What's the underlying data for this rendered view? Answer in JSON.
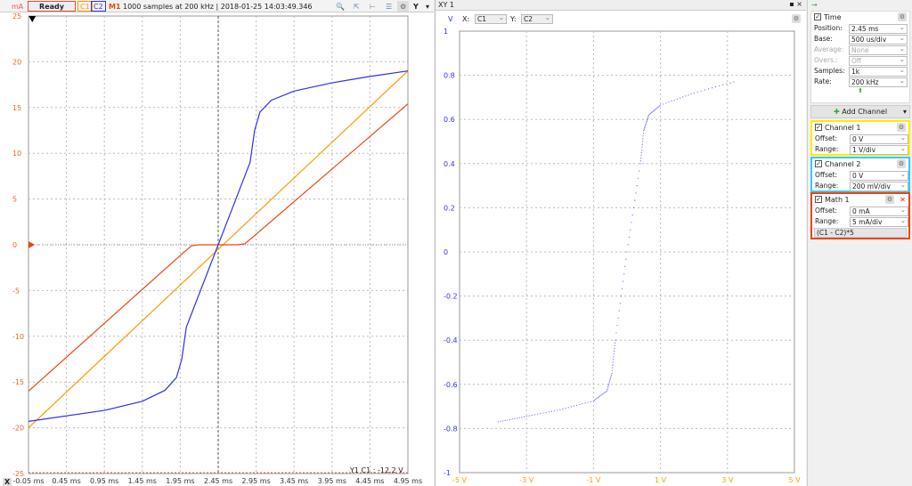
{
  "toolbar": {
    "unit": "mA",
    "status": "Ready",
    "c1": "C1",
    "c2": "C2",
    "m1": "M1",
    "info": "1000 samples at 200 kHz | 2018-01-25 14:03:49.346",
    "y_button": "Y",
    "x_button": "X"
  },
  "colors": {
    "c1": "#ff9900",
    "c2": "#3030ee",
    "m1": "#ee4411",
    "xy": "#6666ff"
  },
  "cursor_readout": "Y1 C1 : -12.2 V",
  "xy": {
    "title": "XY 1",
    "y_unit": "V",
    "x_label": "X:",
    "x_value": "C1",
    "y_label": "Y:",
    "y_value": "C2"
  },
  "side": {
    "time": {
      "title": "Time",
      "position_label": "Position:",
      "position": "2.45 ms",
      "base_label": "Base:",
      "base": "500 us/div",
      "average_label": "Average:",
      "average": "None",
      "overs_label": "Overs.:",
      "overs": "Off",
      "samples_label": "Samples:",
      "samples": "1k",
      "rate_label": "Rate:",
      "rate": "200 kHz"
    },
    "add_channel": "Add Channel",
    "ch1": {
      "title": "Channel 1",
      "offset_label": "Offset:",
      "offset": "0 V",
      "range_label": "Range:",
      "range": "1 V/div"
    },
    "ch2": {
      "title": "Channel 2",
      "offset_label": "Offset:",
      "offset": "0 V",
      "range_label": "Range:",
      "range": "200 mV/div"
    },
    "math1": {
      "title": "Math 1",
      "offset_label": "Offset:",
      "offset": "0 mA",
      "range_label": "Range:",
      "range": "5 mA/div",
      "formula": "(C1 - C2)*5"
    }
  },
  "chart_data": [
    {
      "type": "line",
      "title": "Time plot",
      "xlabel": "ms",
      "ylabel": "mA",
      "xlim": [
        -0.05,
        4.95
      ],
      "ylim": [
        -25,
        25
      ],
      "xticks": [
        "-0.05 ms",
        "0.45 ms",
        "0.95 ms",
        "1.45 ms",
        "1.95 ms",
        "2.45 ms",
        "2.95 ms",
        "3.45 ms",
        "3.95 ms",
        "4.45 ms",
        "4.95 ms"
      ],
      "yticks": [
        "25",
        "20",
        "15",
        "10",
        "5",
        "0",
        "-5",
        "-10",
        "-15",
        "-20",
        "-25"
      ],
      "series": [
        {
          "name": "C1",
          "color": "#ff9900",
          "points": [
            [
              -0.05,
              -20
            ],
            [
              4.95,
              19
            ]
          ]
        },
        {
          "name": "M1",
          "color": "#ee4411",
          "points": [
            [
              -0.05,
              -16
            ],
            [
              2.0,
              -0.8
            ],
            [
              2.1,
              -0.1
            ],
            [
              2.2,
              0
            ],
            [
              2.7,
              0
            ],
            [
              2.8,
              0.1
            ],
            [
              2.9,
              0.8
            ],
            [
              4.95,
              15.4
            ]
          ]
        },
        {
          "name": "C2",
          "color": "#3030ee",
          "points": [
            [
              -0.05,
              -19.3
            ],
            [
              0.95,
              -18.1
            ],
            [
              1.45,
              -17.1
            ],
            [
              1.75,
              -15.9
            ],
            [
              1.9,
              -14.5
            ],
            [
              1.97,
              -12.5
            ],
            [
              2.03,
              -9
            ],
            [
              2.45,
              0
            ],
            [
              2.87,
              9
            ],
            [
              2.93,
              12.5
            ],
            [
              3.0,
              14.5
            ],
            [
              3.15,
              15.8
            ],
            [
              3.45,
              16.8
            ],
            [
              3.95,
              17.7
            ],
            [
              4.45,
              18.4
            ],
            [
              4.95,
              19
            ]
          ]
        }
      ]
    },
    {
      "type": "scatter",
      "title": "XY 1",
      "xlabel": "C1 (V)",
      "ylabel": "C2 (V)",
      "xlim": [
        -5,
        5
      ],
      "ylim": [
        -1,
        1
      ],
      "xticks": [
        "-5 V",
        "-3 V",
        "-1 V",
        "1 V",
        "3 V",
        "5 V"
      ],
      "yticks": [
        "1",
        "0.8",
        "0.6",
        "0.4",
        "0.2",
        "0",
        "-0.2",
        "-0.4",
        "-0.6",
        "-0.8",
        "-1"
      ],
      "points": [
        [
          -3.85,
          -0.77
        ],
        [
          -3,
          -0.745
        ],
        [
          -2,
          -0.715
        ],
        [
          -1,
          -0.675
        ],
        [
          -0.6,
          -0.63
        ],
        [
          -0.45,
          -0.55
        ],
        [
          -0.35,
          -0.4
        ],
        [
          0,
          0
        ],
        [
          0.4,
          0.4
        ],
        [
          0.5,
          0.55
        ],
        [
          0.65,
          0.62
        ],
        [
          1.0,
          0.665
        ],
        [
          2,
          0.72
        ],
        [
          3.3,
          0.775
        ]
      ]
    }
  ]
}
